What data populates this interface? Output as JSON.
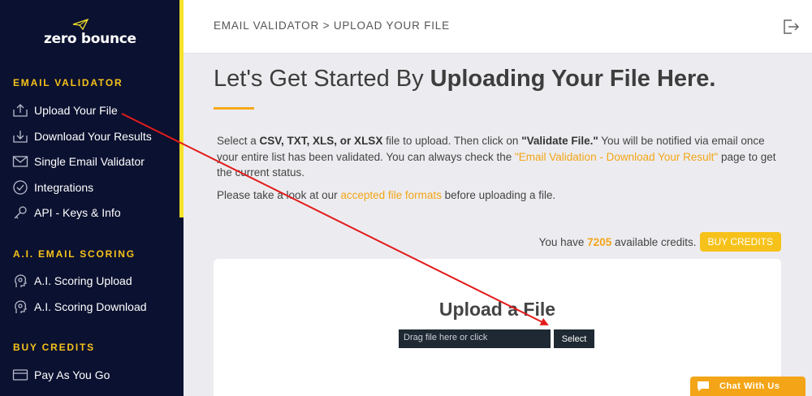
{
  "logo": {
    "text": "zero bounce"
  },
  "sidebar": {
    "sections": [
      {
        "title": "EMAIL VALIDATOR"
      },
      {
        "title": "A.I. EMAIL SCORING"
      },
      {
        "title": "BUY CREDITS"
      }
    ],
    "items": [
      {
        "label": "Upload Your File",
        "icon": "upload-icon"
      },
      {
        "label": "Download Your Results",
        "icon": "download-icon"
      },
      {
        "label": "Single Email Validator",
        "icon": "mail-icon"
      },
      {
        "label": "Integrations",
        "icon": "check-circle-icon"
      },
      {
        "label": "API - Keys & Info",
        "icon": "key-icon"
      },
      {
        "label": "A.I. Scoring Upload",
        "icon": "ai-head-icon"
      },
      {
        "label": "A.I. Scoring Download",
        "icon": "ai-head-icon"
      },
      {
        "label": "Pay As You Go",
        "icon": "wallet-icon"
      }
    ]
  },
  "header": {
    "breadcrumb": "EMAIL VALIDATOR > UPLOAD YOUR FILE"
  },
  "main": {
    "title_plain": "Let's Get Started By ",
    "title_bold": "Uploading Your File Here.",
    "desc": {
      "p1": "Select a ",
      "formats": "CSV, TXT, XLS, or XLSX",
      "p2": " file to upload. Then click on ",
      "validate": "\"Validate File.\"",
      "p3": " You will be notified via email once your entire list has been validated. You can always check the ",
      "link": "\"Email Validation - Download Your Result\"",
      "p4": " page to get the current status."
    },
    "desc2": {
      "p1": "Please take a look at our ",
      "link": "accepted file formats",
      "p2": " before uploading a file."
    },
    "credits": {
      "prefix": "You have ",
      "count": "7205",
      "suffix": " available credits.",
      "buy_label": "BUY CREDITS"
    },
    "upload": {
      "title": "Upload a File",
      "placeholder": "Drag file here or click",
      "select_label": "Select"
    }
  },
  "chat": {
    "label": "Chat With Us"
  },
  "colors": {
    "accent": "#f3a517",
    "sidebar_bg": "#0b1130",
    "annotation_arrow": "#e31b1b"
  }
}
